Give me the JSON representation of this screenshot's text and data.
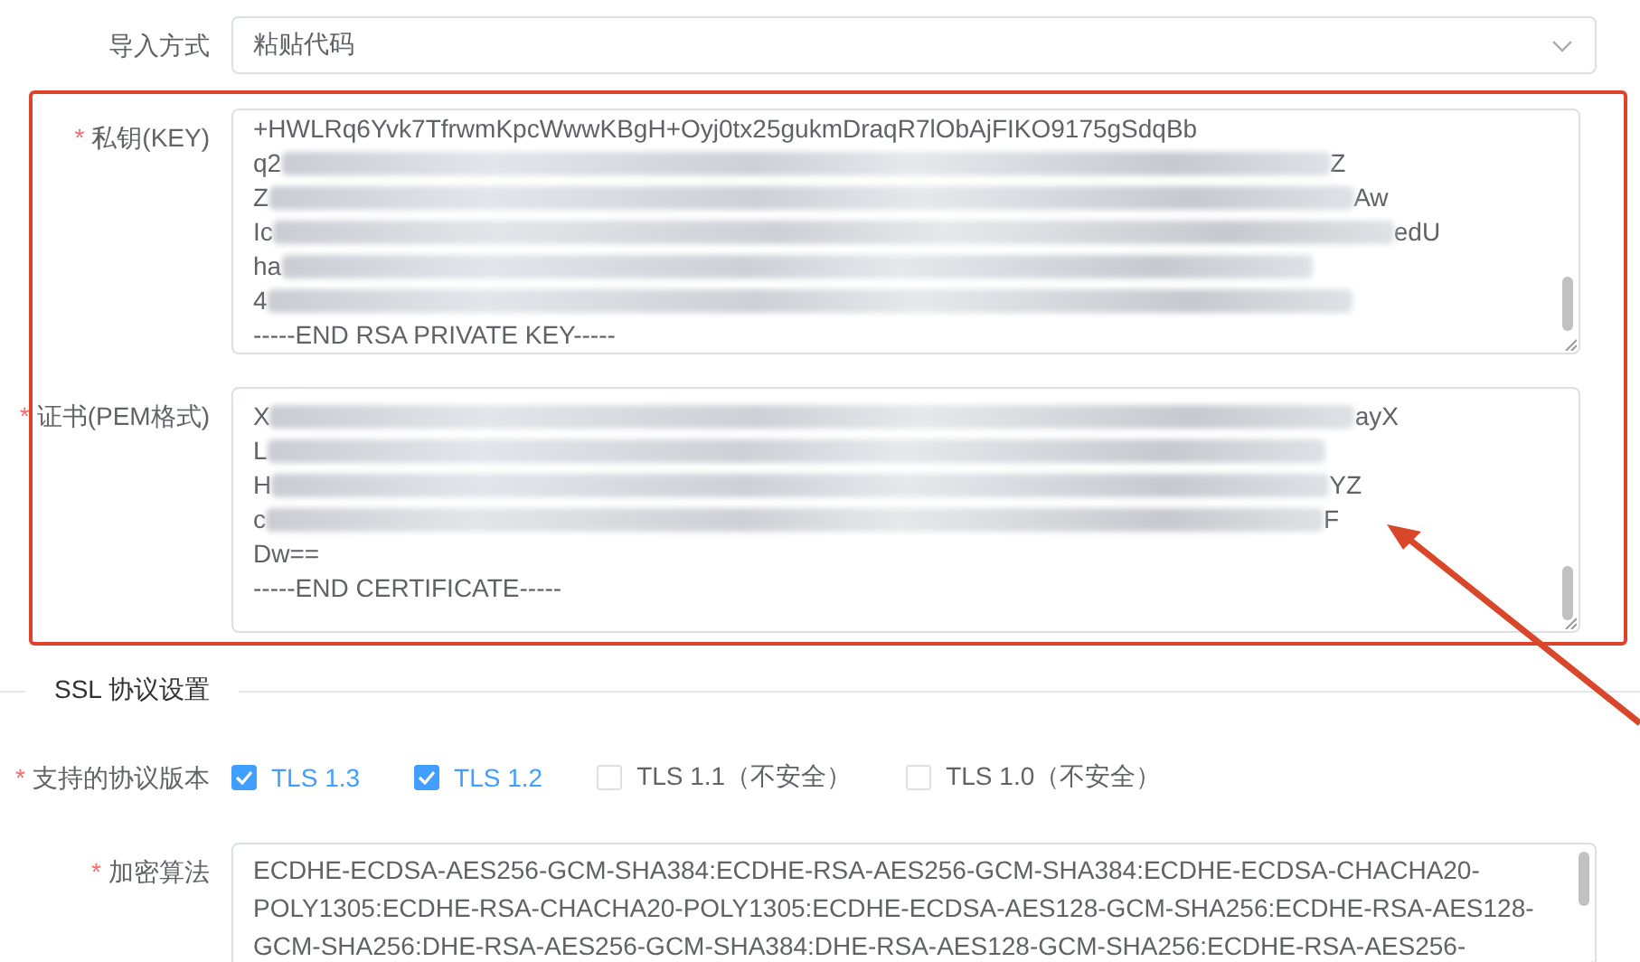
{
  "import_method": {
    "label": "导入方式",
    "value": "粘贴代码"
  },
  "private_key": {
    "label": "私钥(KEY)",
    "required_mark": "*",
    "lines": [
      {
        "kind": "plain",
        "text": "+HWLRq6Yvk7TfrwmKpcWwwKBgH+Oyj0tx25gukmDraqR7lObAjFIKO9175gSdqBb"
      },
      {
        "kind": "blurred",
        "prefix": "q2",
        "suffix": "Z"
      },
      {
        "kind": "blurred",
        "prefix": "Z",
        "suffix": "Aw"
      },
      {
        "kind": "blurred",
        "prefix": "Ic",
        "suffix": "edU"
      },
      {
        "kind": "blurred",
        "prefix": "ha"
      },
      {
        "kind": "blurred",
        "prefix": "4"
      },
      {
        "kind": "plain",
        "text": "-----END RSA PRIVATE KEY-----"
      }
    ]
  },
  "certificate": {
    "label": "证书(PEM格式)",
    "required_mark": "*",
    "lines": [
      {
        "kind": "blurred",
        "prefix": "X",
        "suffix": "ayX"
      },
      {
        "kind": "blurred",
        "prefix": "L"
      },
      {
        "kind": "blurred",
        "prefix": "H",
        "suffix": "YZ"
      },
      {
        "kind": "blurred",
        "prefix": "c",
        "suffix": "F"
      },
      {
        "kind": "plain",
        "text": "Dw=="
      },
      {
        "kind": "plain",
        "text": "-----END CERTIFICATE-----"
      }
    ]
  },
  "ssl_section": {
    "title": "SSL 协议设置"
  },
  "protocols": {
    "label": "支持的协议版本",
    "required_mark": "*",
    "options": [
      {
        "label": "TLS 1.3",
        "checked": true
      },
      {
        "label": "TLS 1.2",
        "checked": true
      },
      {
        "label": "TLS 1.1（不安全）",
        "checked": false
      },
      {
        "label": "TLS 1.0（不安全）",
        "checked": false
      }
    ]
  },
  "ciphers": {
    "label": "加密算法",
    "required_mark": "*",
    "value": "ECDHE-ECDSA-AES256-GCM-SHA384:ECDHE-RSA-AES256-GCM-SHA384:ECDHE-ECDSA-CHACHA20-POLY1305:ECDHE-RSA-CHACHA20-POLY1305:ECDHE-ECDSA-AES128-GCM-SHA256:ECDHE-RSA-AES128-GCM-SHA256:DHE-RSA-AES256-GCM-SHA384:DHE-RSA-AES128-GCM-SHA256:ECDHE-RSA-AES256-"
  }
}
